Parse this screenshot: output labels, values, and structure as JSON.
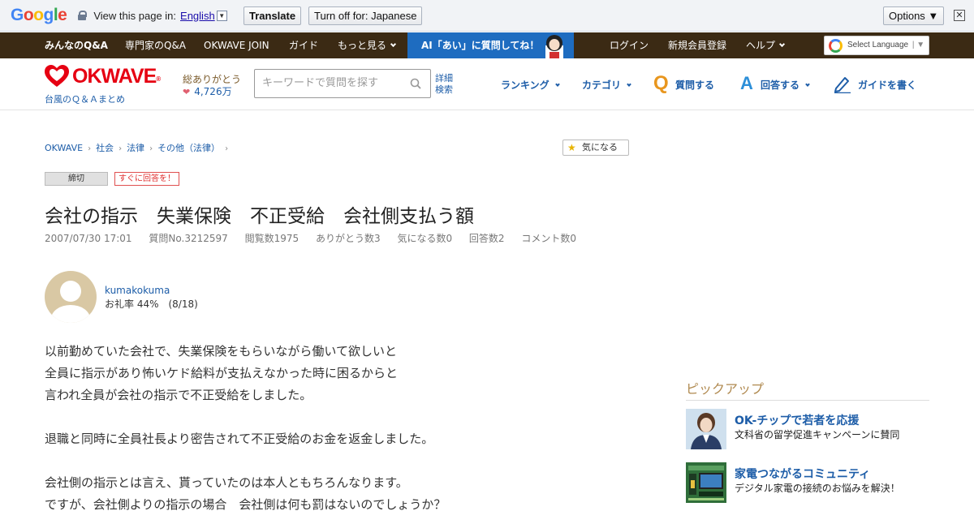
{
  "translate_bar": {
    "logo": "Google",
    "view_text": "View this page in:",
    "language": "English",
    "translate_label": "Translate",
    "turn_off_label": "Turn off for: Japanese",
    "options_label": "Options ▼",
    "close_label": "✕"
  },
  "topnav": {
    "items": [
      "みんなのQ&A",
      "専門家のQ&A",
      "OKWAVE JOIN",
      "ガイド",
      "もっと見る"
    ],
    "ai_label": "AI「あい」に質問してね！",
    "login": "ログイン",
    "register": "新規会員登録",
    "help": "ヘルプ",
    "select_language": "Select Language"
  },
  "header": {
    "logo_text": "OKWAVE",
    "logo_reg": "®",
    "logo_sub": "台風のＱ＆Ａまとめ",
    "thanks_label": "総ありがとう",
    "thanks_value": "4,726万",
    "search_placeholder": "キーワードで質問を探す",
    "detail_search_1": "詳細",
    "detail_search_2": "検索",
    "ranking": "ランキング",
    "category": "カテゴリ",
    "ask": "質問する",
    "answer": "回答する",
    "write_guide": "ガイドを書く"
  },
  "breadcrumb": [
    "OKWAVE",
    "社会",
    "法律",
    "その他（法律）"
  ],
  "watch_button": "気になる",
  "badges": {
    "closed": "締切",
    "answer_now": "すぐに回答を！"
  },
  "question": {
    "title": "会社の指示　失業保険　不正受給　会社側支払う額",
    "date": "2007/07/30 17:01",
    "number": "質問No.3212597",
    "views": "閲覧数1975",
    "thanks": "ありがとう数3",
    "watch": "気になる数0",
    "answers": "回答数2",
    "comments": "コメント数0",
    "username": "kumakokuma",
    "thanks_rate": "お礼率 44%　(8/18)",
    "body": [
      "以前勤めていた会社で、失業保険をもらいながら働いて欲しいと",
      "全員に指示があり怖いケド給料が支払えなかった時に困るからと",
      "言われ全員が会社の指示で不正受給をしました。",
      "",
      "退職と同時に全員社長より密告されて不正受給のお金を返金しました。",
      "",
      "会社側の指示とは言え、貰っていたのは本人ともちろんなります。",
      "ですが、会社側よりの指示の場合　会社側は何も罰はないのでしょうか？"
    ]
  },
  "sidebar": {
    "pickup_title": "ピックアップ",
    "items": [
      {
        "title": "OK-チップで若者を応援",
        "desc": "文科省の留学促進キャンペーンに賛同"
      },
      {
        "title": "家電つながるコミュニティ",
        "desc": "デジタル家電の接続のお悩みを解決！"
      }
    ]
  },
  "colors": {
    "nav_bg": "#3b2a14",
    "ai_bg": "#1e6cc0",
    "brand_red": "#e60012",
    "link_blue": "#1d5da8",
    "pickup_gold": "#b08a50"
  }
}
